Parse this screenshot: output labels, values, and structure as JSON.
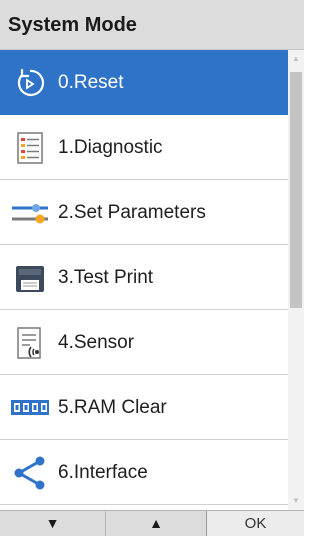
{
  "header": {
    "title": "System Mode"
  },
  "menu": {
    "items": [
      {
        "label": "0.Reset",
        "icon": "reset-icon",
        "selected": true
      },
      {
        "label": "1.Diagnostic",
        "icon": "checklist-icon",
        "selected": false
      },
      {
        "label": "2.Set Parameters",
        "icon": "sliders-icon",
        "selected": false
      },
      {
        "label": "3.Test Print",
        "icon": "printer-icon",
        "selected": false
      },
      {
        "label": "4.Sensor",
        "icon": "sensor-icon",
        "selected": false
      },
      {
        "label": "5.RAM Clear",
        "icon": "memory-icon",
        "selected": false
      },
      {
        "label": "6.Interface",
        "icon": "share-icon",
        "selected": false
      }
    ]
  },
  "footer": {
    "down_label": "▼",
    "up_label": "▲",
    "ok_label": "OK"
  },
  "colors": {
    "selection": "#2f73c9",
    "header_bg": "#dcdcdc",
    "accent_orange": "#f5a623",
    "accent_blue": "#2f73c9"
  }
}
